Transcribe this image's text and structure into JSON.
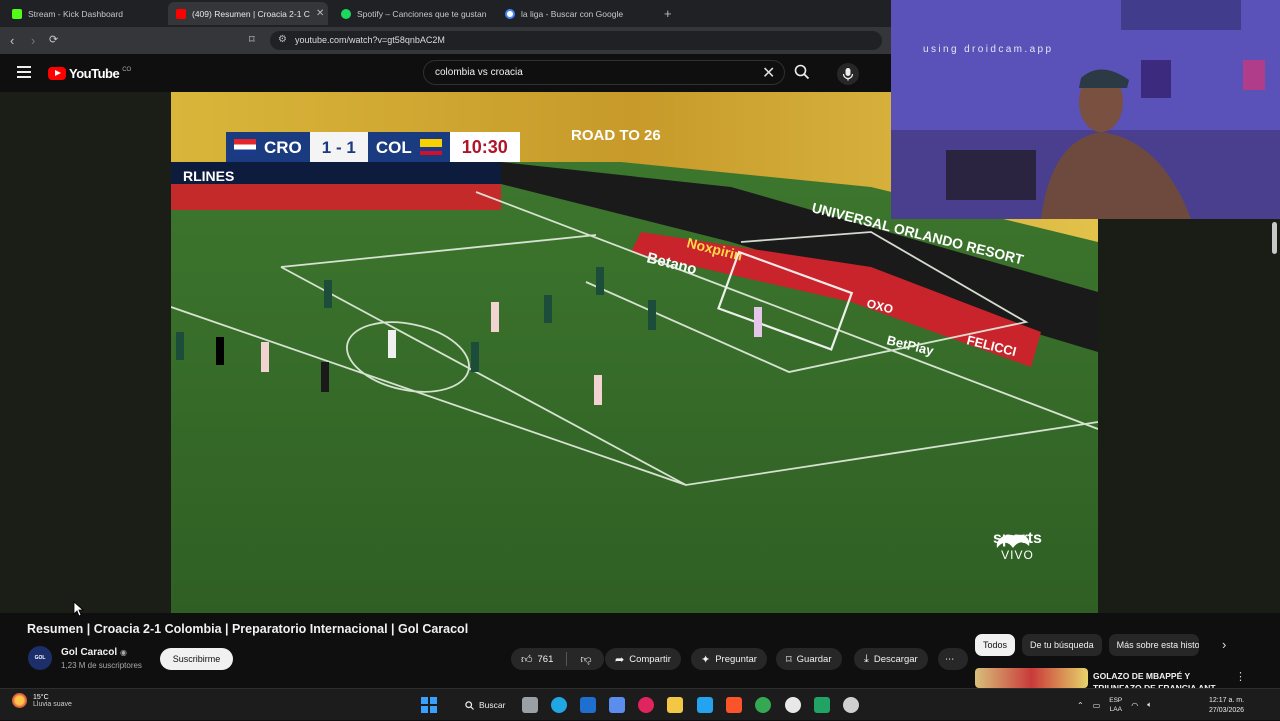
{
  "browser": {
    "tabs": [
      {
        "label": "Stream - Kick Dashboard",
        "favicon_color": "#53fc18",
        "active": false
      },
      {
        "label": "(409) Resumen | Croacia 2-1 C",
        "favicon_color": "#ff0000",
        "active": true
      },
      {
        "label": "Spotify – Canciones que te gustan",
        "favicon_color": "#1ed760",
        "active": false
      },
      {
        "label": "la liga - Buscar con Google",
        "favicon_color": "#ffffff",
        "active": false
      }
    ],
    "new_tab_symbol": "+",
    "url": "youtube.com/watch?v=gt58qnbAC2M",
    "icons": [
      "back-icon",
      "forward-icon",
      "reload-icon",
      "bookmark-icon",
      "site-info-icon"
    ]
  },
  "youtube_header": {
    "logo_text": "YouTube",
    "country_code": "CO",
    "search_query": "colombia vs croacia"
  },
  "video": {
    "scoreboard": {
      "home": "CRO",
      "score": "1 - 1",
      "away": "COL",
      "clock": "10:30"
    },
    "broadcaster": "sports",
    "broadcaster_sub": "VIVO",
    "ad_boards": [
      "ROAD TO 26",
      "UNIVERSAL ORLANDO RESORT",
      "Betano",
      "Noxpirin",
      "BetPlay",
      "FELICCI",
      "OXO",
      "RLINES"
    ]
  },
  "webcam": {
    "watermark": "using droidcam.app"
  },
  "video_info": {
    "title": "Resumen | Croacia 2-1 Colombia | Preparatorio Internacional | Gol Caracol",
    "channel_avatar_text": "GOL",
    "channel_name": "Gol Caracol",
    "verified_symbol": "◉",
    "subscribers": "1,23 M de suscriptores",
    "subscribe_label": "Suscribirme",
    "like_count": "761",
    "share_label": "Compartir",
    "ask_label": "Preguntar",
    "save_label": "Guardar",
    "download_label": "Descargar",
    "more_symbol": "⋯"
  },
  "sidebar": {
    "chips": [
      "Todos",
      "De tu búsqueda",
      "Más sobre esta histo"
    ],
    "recommendation_title": "GOLAZO DE MBAPPÉ Y TRIUNFAZO DE FRANCIA ANT"
  },
  "taskbar": {
    "weather_temp": "15°C",
    "weather_desc": "Lluvia suave",
    "search_label": "Buscar",
    "lang_top": "ESP",
    "lang_bottom": "LAA",
    "time": "12:17 a. m.",
    "date": "27/03/2026",
    "apps": [
      {
        "name": "task-view-icon",
        "color": "#9aa0a6"
      },
      {
        "name": "edge-icon",
        "color": "#1fa6e3"
      },
      {
        "name": "outlook-icon",
        "color": "#1f6fd1"
      },
      {
        "name": "copilot-icon",
        "color": "#5b8def"
      },
      {
        "name": "circle-app-icon",
        "color": "#e0245e"
      },
      {
        "name": "explorer-icon",
        "color": "#f2c744"
      },
      {
        "name": "vscode-icon",
        "color": "#23a3f0"
      },
      {
        "name": "brave-icon",
        "color": "#fb542b"
      },
      {
        "name": "chrome-icon",
        "color": "#34a853"
      },
      {
        "name": "chrome-profile-icon",
        "color": "#e8e8e8"
      },
      {
        "name": "sheets-app-icon",
        "color": "#21a366"
      },
      {
        "name": "obs-icon",
        "color": "#d0d0d0"
      }
    ]
  }
}
